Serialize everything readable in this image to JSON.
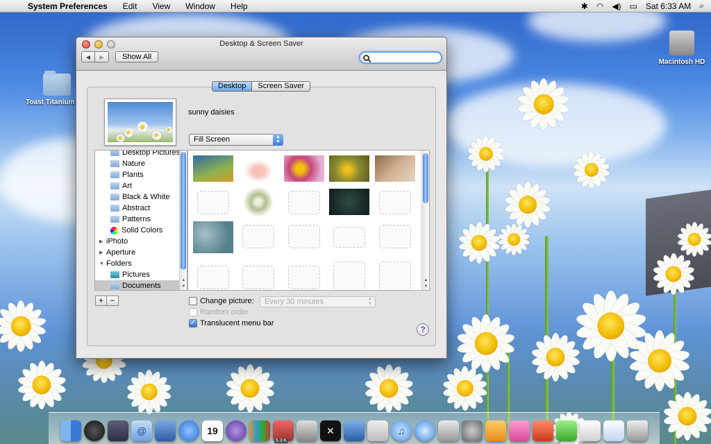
{
  "menubar": {
    "app_name": "System Preferences",
    "items": [
      "Edit",
      "View",
      "Window",
      "Help"
    ],
    "clock": "Sat 6:33 AM"
  },
  "desktop": {
    "left_icon_label": "Toast Titanium Pro",
    "right_icon_label": "Macintosh HD"
  },
  "window": {
    "title": "Desktop & Screen Saver",
    "show_all_label": "Show All",
    "search_value": "",
    "tabs": [
      {
        "label": "Desktop",
        "active": true
      },
      {
        "label": "Screen Saver",
        "active": false
      }
    ],
    "preview_title": "sunny daisies",
    "fill_mode": "Fill Screen"
  },
  "sources": [
    {
      "label": "Desktop Pictures",
      "type": "folder",
      "indent": 2
    },
    {
      "label": "Nature",
      "type": "folder",
      "indent": 2
    },
    {
      "label": "Plants",
      "type": "folder",
      "indent": 2
    },
    {
      "label": "Art",
      "type": "folder",
      "indent": 2
    },
    {
      "label": "Black & White",
      "type": "folder",
      "indent": 2
    },
    {
      "label": "Abstract",
      "type": "folder",
      "indent": 2
    },
    {
      "label": "Patterns",
      "type": "folder",
      "indent": 2
    },
    {
      "label": "Solid Colors",
      "type": "colors",
      "indent": 2
    },
    {
      "label": "iPhoto",
      "type": "group-collapsed",
      "indent": 1
    },
    {
      "label": "Aperture",
      "type": "group-collapsed",
      "indent": 1
    },
    {
      "label": "Folders",
      "type": "group-expanded",
      "indent": 1
    },
    {
      "label": "Pictures",
      "type": "teal-folder",
      "indent": 2
    },
    {
      "label": "Documents",
      "type": "folder",
      "indent": 2,
      "selected": true
    }
  ],
  "options": {
    "change_picture_label": "Change picture:",
    "change_picture_checked": false,
    "interval": "Every 30 minutes",
    "random_order_label": "Random order",
    "translucent_label": "Translucent menu bar",
    "translucent_checked": true
  },
  "dock": {
    "badge_text": "5.3 K"
  }
}
